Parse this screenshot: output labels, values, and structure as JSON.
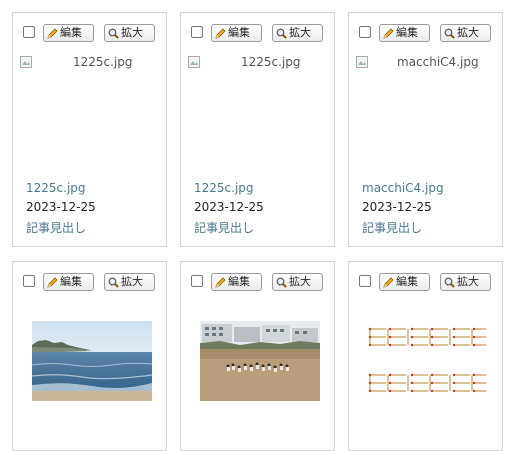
{
  "buttons": {
    "edit_label": "編集",
    "zoom_label": "拡大"
  },
  "icons": {
    "edit": "pencil-icon",
    "zoom": "magnifier-icon",
    "broken": "broken-image-icon"
  },
  "colors": {
    "link": "#4a7a8a",
    "border": "#d6d6d6"
  },
  "cards": [
    {
      "alt": "1225c.jpg",
      "filename": "1225c.jpg",
      "date": "2023-12-25",
      "headline": "記事見出し"
    },
    {
      "alt": "1225c.jpg",
      "filename": "1225c.jpg",
      "date": "2023-12-25",
      "headline": "記事見出し"
    },
    {
      "alt": "macchiC4.jpg",
      "filename": "macchiC4.jpg",
      "date": "2023-12-25",
      "headline": "記事見出し"
    },
    {
      "thumbnail": "sea-coast-photo"
    },
    {
      "thumbnail": "beach-crowd-photo"
    },
    {
      "thumbnail": "matchstick-puzzle-photo"
    }
  ]
}
